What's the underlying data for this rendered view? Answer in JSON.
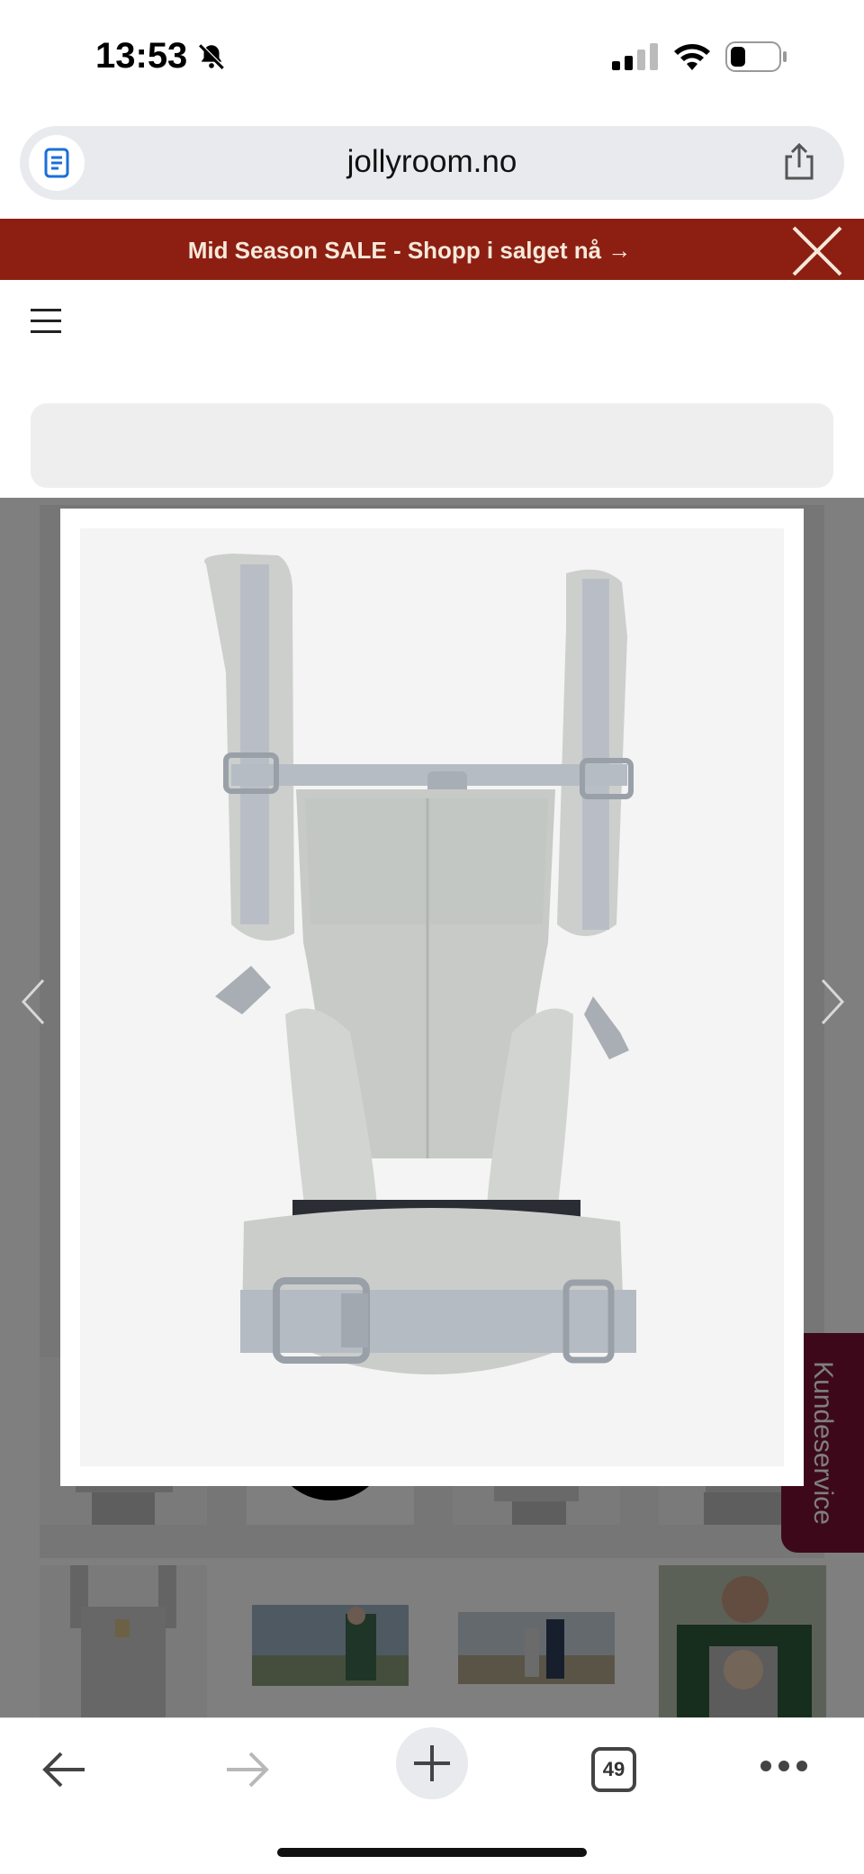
{
  "status": {
    "time": "13:53",
    "bell": "bell-slash-icon",
    "signal": "cellular-signal-icon",
    "wifi": "wifi-icon",
    "battery": "battery-icon"
  },
  "browser": {
    "url": "jollyroom.no",
    "tab_count": "49",
    "icons": {
      "reader": "reader-mode-icon",
      "share": "share-icon",
      "back": "arrow-left-icon",
      "forward": "arrow-right-icon",
      "new_tab": "plus-icon",
      "more": "more-dots-icon"
    }
  },
  "page": {
    "banner_text": "Mid Season SALE - Shopp i salget nå →",
    "kundeservice": "Kundeservice",
    "thumbnails": [
      {
        "name": "carrier-front-view"
      },
      {
        "name": "video-thumbnail",
        "icon": "youtube-play-icon"
      },
      {
        "name": "carrier-side-view"
      },
      {
        "name": "carrier-back-view"
      },
      {
        "name": "carrier-folded-view"
      },
      {
        "name": "lifestyle-photo-father"
      },
      {
        "name": "lifestyle-photo-desert"
      },
      {
        "name": "lifestyle-photo-closeup"
      }
    ]
  },
  "colors": {
    "banner_bg": "#8c1f12",
    "banner_text": "#f5e9da",
    "kundeservice_bg": "#7a1234"
  }
}
